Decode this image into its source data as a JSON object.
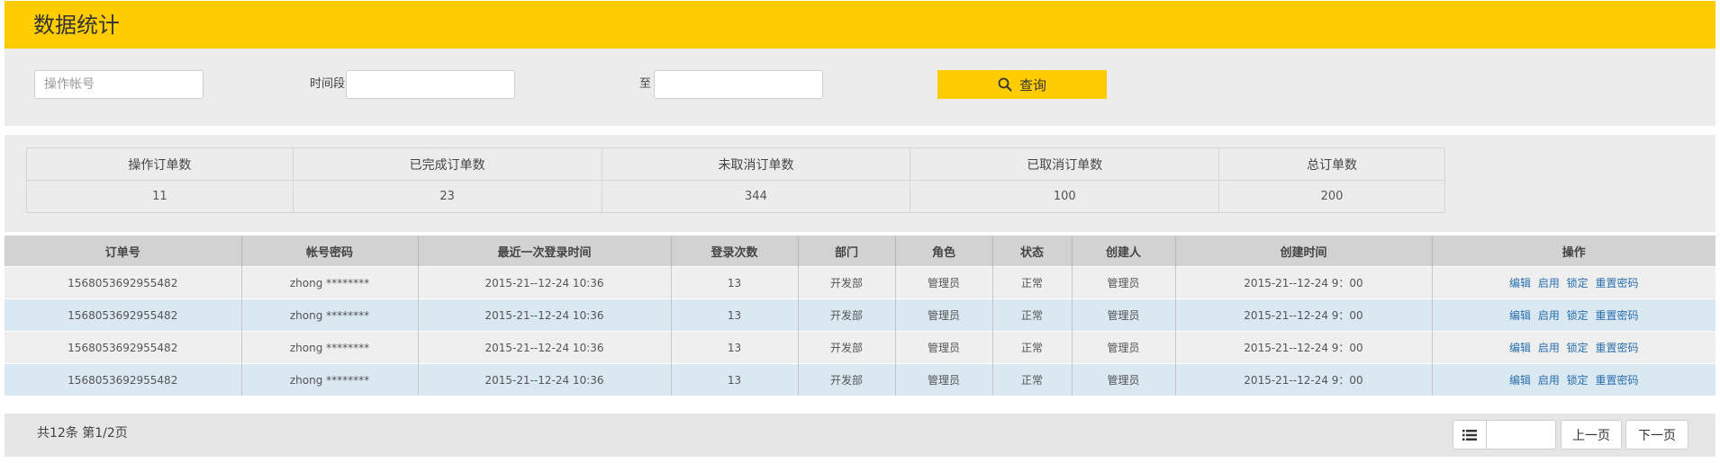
{
  "header": {
    "title": "数据统计"
  },
  "filters": {
    "account_placeholder": "操作帐号",
    "period_label": "时间段",
    "to_label": "至",
    "query_label": "查询"
  },
  "stats": {
    "headers": [
      "操作订单数",
      "已完成订单数",
      "未取消订单数",
      "已取消订单数",
      "总订单数"
    ],
    "values": [
      "11",
      "23",
      "344",
      "100",
      "200"
    ]
  },
  "table": {
    "columns": [
      "订单号",
      "帐号密码",
      "最近一次登录时间",
      "登录次数",
      "部门",
      "角色",
      "状态",
      "创建人",
      "创建时间",
      "操作"
    ],
    "rows": [
      [
        "1568053692955482",
        "zhong ********",
        "2015-21--12-24 10:36",
        "13",
        "开发部",
        "管理员",
        "正常",
        "管理员",
        "2015-21--12-24 9：00"
      ],
      [
        "1568053692955482",
        "zhong ********",
        "2015-21--12-24 10:36",
        "13",
        "开发部",
        "管理员",
        "正常",
        "管理员",
        "2015-21--12-24 9：00"
      ],
      [
        "1568053692955482",
        "zhong ********",
        "2015-21--12-24 10:36",
        "13",
        "开发部",
        "管理员",
        "正常",
        "管理员",
        "2015-21--12-24 9：00"
      ],
      [
        "1568053692955482",
        "zhong ********",
        "2015-21--12-24 10:36",
        "13",
        "开发部",
        "管理员",
        "正常",
        "管理员",
        "2015-21--12-24 9：00"
      ]
    ],
    "actions": [
      "编辑",
      "启用",
      "锁定",
      "重置密码"
    ]
  },
  "pagination": {
    "summary": "共12条 第1/2页",
    "prev_label": "上一页",
    "next_label": "下一页",
    "page_value": ""
  }
}
